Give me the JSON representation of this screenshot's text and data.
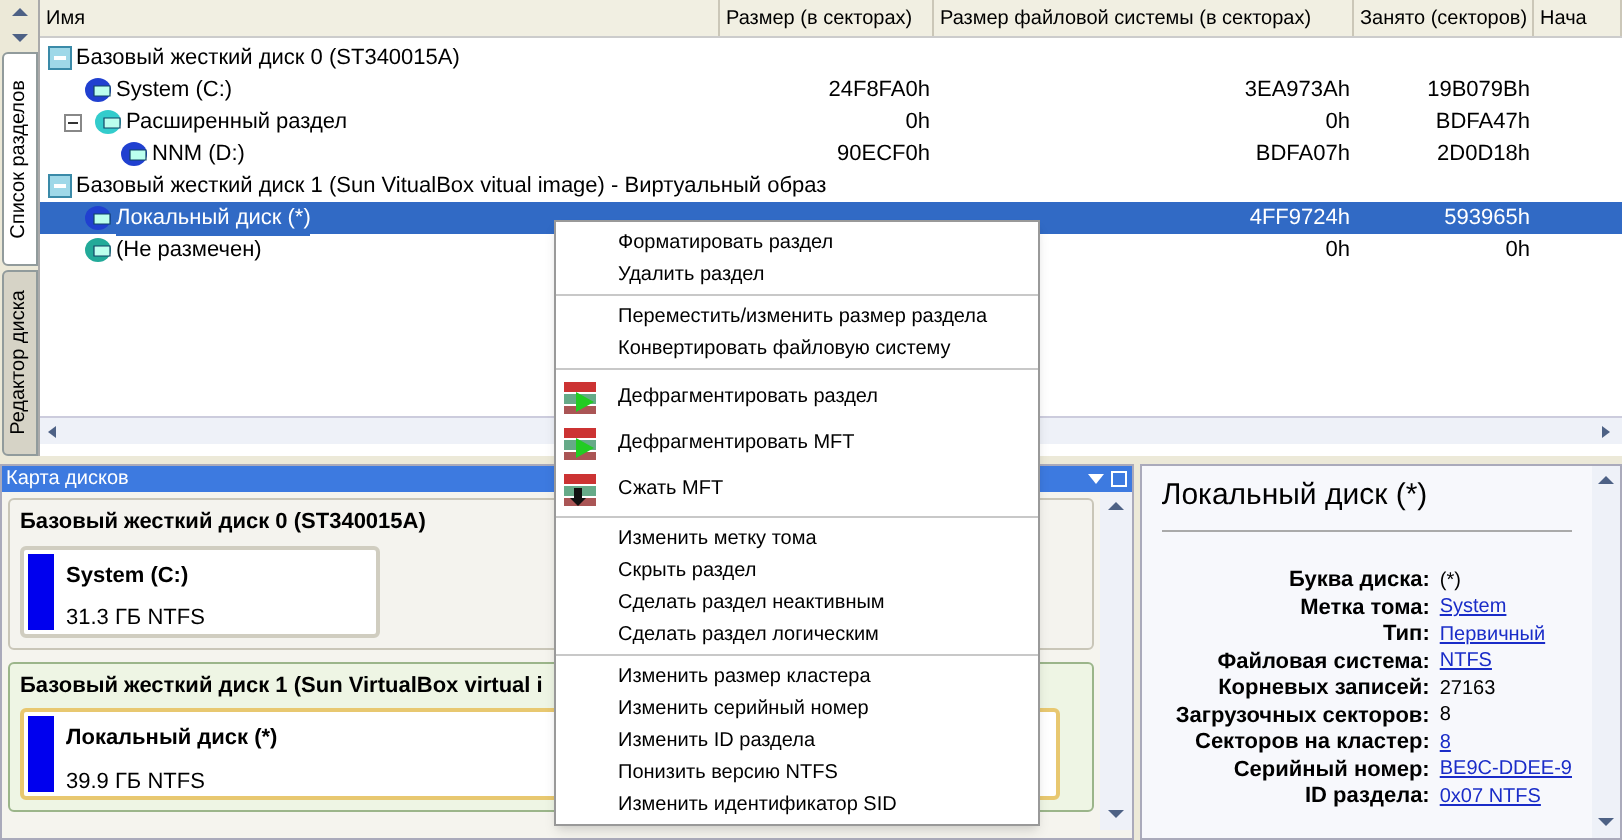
{
  "side_tabs": [
    {
      "label": "Список разделов",
      "selected": true
    },
    {
      "label": "Редактор диска",
      "selected": false
    }
  ],
  "table": {
    "columns": [
      "Имя",
      "Размер (в секторах)",
      "Размер файловой системы (в секторах)",
      "Занято (секторов)",
      "Нача"
    ],
    "rows": [
      {
        "kind": "disk",
        "name": "Базовый жесткий диск 0 (ST340015A)",
        "selected": false,
        "children": [
          {
            "kind": "partition",
            "name": "System (C:)",
            "cells": [
              "24F8FA0h",
              "3EA973Ah",
              "19B079Bh"
            ],
            "selected": false
          },
          {
            "kind": "extended",
            "name": "Расширенный раздел",
            "cells": [
              "0h",
              "0h",
              "BDFA47h"
            ],
            "selected": false,
            "expanded": true,
            "children": [
              {
                "kind": "partition",
                "name": "NNM (D:)",
                "cells": [
                  "90ECF0h",
                  "BDFA07h",
                  "2D0D18h"
                ],
                "selected": false
              }
            ]
          }
        ]
      },
      {
        "kind": "disk",
        "name": "Базовый жесткий диск 1 (Sun VitualBox vitual image) - Виртуальный образ",
        "selected": false,
        "children": [
          {
            "kind": "partition",
            "name": "Локальный диск (*)",
            "cells": [
              "",
              "4FF9724h",
              "593965h"
            ],
            "selected": true
          },
          {
            "kind": "unallocated",
            "name": "(Не размечен)",
            "cells": [
              "",
              "0h",
              "0h"
            ],
            "selected": false
          }
        ]
      }
    ]
  },
  "disk_map": {
    "title": "Карта дисков",
    "disks": [
      {
        "title": "Базовый жесткий диск 0 (ST340015A)",
        "selected": false,
        "partitions": [
          {
            "name": "System (C:)",
            "size": "31.3 ГБ NTFS",
            "selected": false
          }
        ]
      },
      {
        "title": "Базовый жесткий диск 1 (Sun VirtualBox virtual i",
        "selected": true,
        "partitions": [
          {
            "name": "Локальный диск (*)",
            "size": "39.9 ГБ NTFS",
            "selected": true
          }
        ]
      }
    ]
  },
  "info": {
    "title": "Локальный диск (*)",
    "rows": [
      {
        "label": "Буква диска:",
        "value": "(*)",
        "kind": "text"
      },
      {
        "label": "Метка тома:",
        "value": "System",
        "kind": "link"
      },
      {
        "label": "Тип:",
        "value": "Первичный",
        "kind": "link"
      },
      {
        "label": "Файловая система:",
        "value": "NTFS",
        "kind": "link"
      },
      {
        "label": "Корневых записей:",
        "value": "27163",
        "kind": "text"
      },
      {
        "label": "Загрузочных секторов:",
        "value": "8",
        "kind": "text"
      },
      {
        "label": "Секторов на кластер:",
        "value": "8",
        "kind": "link"
      },
      {
        "label": "Серийный номер:",
        "value": "BE9C-DDEE-9",
        "kind": "link"
      },
      {
        "label": "ID раздела:",
        "value": "0x07 NTFS",
        "kind": "link"
      }
    ]
  },
  "context_menu": {
    "groups": [
      [
        {
          "label": "Форматировать раздел",
          "kind": "plain"
        },
        {
          "label": "Удалить раздел",
          "kind": "plain"
        }
      ],
      [
        {
          "label": "Переместить/изменить размер раздела",
          "kind": "plain"
        },
        {
          "label": "Конвертировать файловую систему",
          "kind": "plain"
        }
      ],
      [
        {
          "label": "Дефрагментировать раздел",
          "kind": "icon"
        },
        {
          "label": "Дефрагментировать MFT",
          "kind": "icon"
        },
        {
          "label": "Сжать MFT",
          "kind": "icon"
        }
      ],
      [
        {
          "label": "Изменить метку тома",
          "kind": "plain"
        },
        {
          "label": "Скрыть раздел",
          "kind": "plain"
        },
        {
          "label": "Сделать раздел неактивным",
          "kind": "plain"
        },
        {
          "label": "Сделать раздел логическим",
          "kind": "plain"
        }
      ],
      [
        {
          "label": "Изменить размер кластера",
          "kind": "plain"
        },
        {
          "label": "Изменить серийный номер",
          "kind": "plain"
        },
        {
          "label": "Изменить ID раздела",
          "kind": "plain"
        },
        {
          "label": "Понизить версию NTFS",
          "kind": "plain"
        },
        {
          "label": "Изменить идентификатор SID",
          "kind": "plain"
        }
      ]
    ]
  }
}
